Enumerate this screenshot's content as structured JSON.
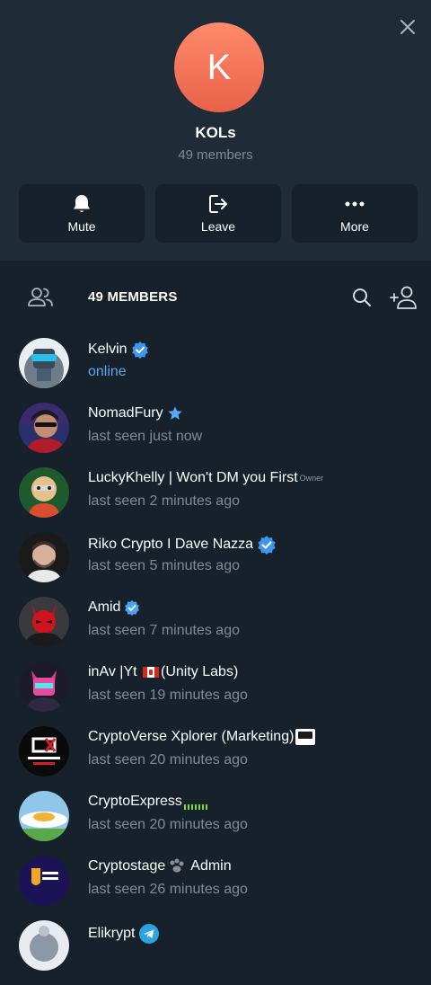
{
  "group": {
    "avatar_letter": "K",
    "title": "KOLs",
    "subtitle": "49 members",
    "avatar_color": "#f07456"
  },
  "actions": [
    {
      "label": "Mute",
      "icon": "bell-icon"
    },
    {
      "label": "Leave",
      "icon": "leave-icon"
    },
    {
      "label": "More",
      "icon": "more-icon"
    }
  ],
  "members_header": {
    "count_label": "49 MEMBERS"
  },
  "members": [
    {
      "name": "Kelvin",
      "status": "online",
      "badge": "verified-icon"
    },
    {
      "name": "NomadFury",
      "status": "last seen just now",
      "badge": "star-icon"
    },
    {
      "name": "LuckyKhelly | Won't DM you First",
      "status": "last seen 2 minutes ago",
      "tag": "Owner"
    },
    {
      "name": "Riko Crypto I Dave Nazza",
      "status": "last seen 5 minutes ago",
      "badge": "verified-icon"
    },
    {
      "name": "Amid",
      "status": "last seen 7 minutes ago",
      "badge": "verified-icon"
    },
    {
      "name_pre": "inAv |Yt",
      "name_post": "(Unity Labs)",
      "status": "last seen 19 minutes ago",
      "badge": "canada-flag-icon"
    },
    {
      "name": "CryptoVerse Xplorer (Marketing)",
      "status": "last seen 20 minutes ago",
      "badge": "cryptoverse-logo-icon"
    },
    {
      "name": "CryptoExpress",
      "status": "last seen 20 minutes ago",
      "badge": "pixel-emoji-icon"
    },
    {
      "name_pre": "Cryptostage",
      "name_post": "Admin",
      "status": "last seen 26 minutes ago",
      "badge": "paw-icon"
    },
    {
      "name": "Elikrypt",
      "status": "",
      "badge": "telegram-icon"
    }
  ],
  "colors": {
    "background": "#17212b",
    "header_bg": "#1f2b36",
    "accent_blue": "#5fa7e8",
    "muted_text": "#7e8b99"
  }
}
